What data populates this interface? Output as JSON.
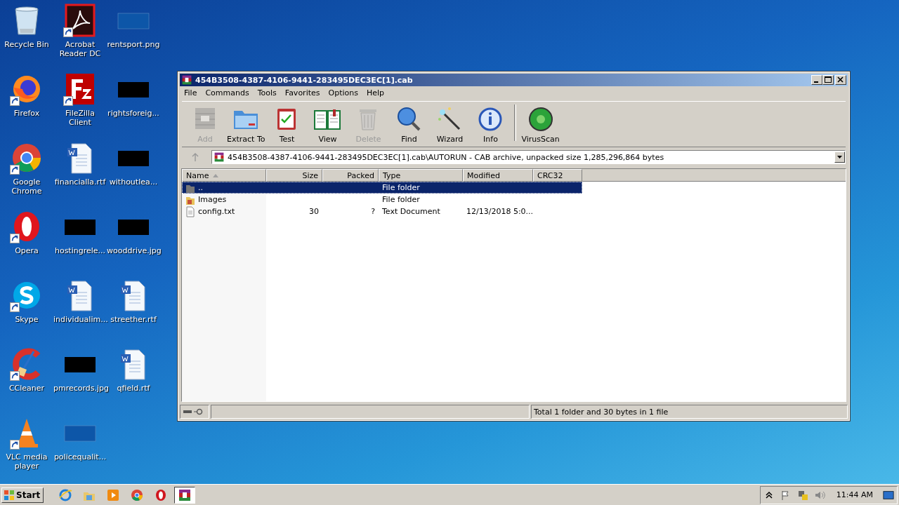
{
  "desktop_icons": [
    {
      "label": "Recycle Bin",
      "kind": "recycle",
      "shortcut": false
    },
    {
      "label": "Firefox",
      "kind": "firefox",
      "shortcut": true
    },
    {
      "label": "Google Chrome",
      "kind": "chrome",
      "shortcut": true
    },
    {
      "label": "Opera",
      "kind": "opera",
      "shortcut": true
    },
    {
      "label": "Skype",
      "kind": "skype",
      "shortcut": true
    },
    {
      "label": "CCleaner",
      "kind": "ccleaner",
      "shortcut": true
    },
    {
      "label": "VLC media player",
      "kind": "vlc",
      "shortcut": true
    },
    {
      "label": "Acrobat Reader DC",
      "kind": "acrobat",
      "shortcut": true
    },
    {
      "label": "FileZilla Client",
      "kind": "filezilla",
      "shortcut": true
    },
    {
      "label": "financialla.rtf",
      "kind": "word",
      "shortcut": false
    },
    {
      "label": "hostingrele...",
      "kind": "dark-image",
      "shortcut": false
    },
    {
      "label": "individualim...",
      "kind": "word",
      "shortcut": false
    },
    {
      "label": "pmrecords.jpg",
      "kind": "dark-image",
      "shortcut": false
    },
    {
      "label": "policequalit...",
      "kind": "blank-image",
      "shortcut": false
    },
    {
      "label": "rentsport.png",
      "kind": "blank-image",
      "shortcut": false
    },
    {
      "label": "rightsforeig...",
      "kind": "dark-image",
      "shortcut": false
    },
    {
      "label": "withoutlea...",
      "kind": "dark-image",
      "shortcut": false
    },
    {
      "label": "wooddrive.jpg",
      "kind": "dark-image",
      "shortcut": false
    },
    {
      "label": "streether.rtf",
      "kind": "word",
      "shortcut": false
    },
    {
      "label": "qfield.rtf",
      "kind": "word",
      "shortcut": false
    }
  ],
  "window": {
    "title": "454B3508-4387-4106-9441-283495DEC3EC[1].cab",
    "menu": [
      "File",
      "Commands",
      "Tools",
      "Favorites",
      "Options",
      "Help"
    ],
    "toolbar": [
      {
        "label": "Add",
        "kind": "add",
        "disabled": true
      },
      {
        "label": "Extract To",
        "kind": "extract",
        "disabled": false
      },
      {
        "label": "Test",
        "kind": "test",
        "disabled": false
      },
      {
        "label": "View",
        "kind": "view",
        "disabled": false
      },
      {
        "label": "Delete",
        "kind": "delete",
        "disabled": true
      },
      {
        "label": "Find",
        "kind": "find",
        "disabled": false
      },
      {
        "label": "Wizard",
        "kind": "wizard",
        "disabled": false
      },
      {
        "label": "Info",
        "kind": "info",
        "disabled": false
      },
      {
        "label": "VirusScan",
        "kind": "virusscan",
        "disabled": false
      }
    ],
    "address": "454B3508-4387-4106-9441-283495DEC3EC[1].cab\\AUTORUN - CAB archive, unpacked size 1,285,296,864 bytes",
    "columns": [
      "Name",
      "Size",
      "Packed",
      "Type",
      "Modified",
      "CRC32"
    ],
    "rows": [
      {
        "kind": "parent",
        "name": "..",
        "type": "File folder",
        "selected": true
      },
      {
        "kind": "folder",
        "name": "Images",
        "type": "File folder",
        "selected": false
      },
      {
        "kind": "file",
        "name": "config.txt",
        "size": "30",
        "packed": "?",
        "type": "Text Document",
        "modified": "12/13/2018 5:0...",
        "selected": false
      }
    ],
    "status": "Total 1 folder and 30 bytes in 1 file"
  },
  "taskbar": {
    "start": "Start",
    "items": [
      {
        "kind": "ie",
        "selected": false
      },
      {
        "kind": "explorer",
        "selected": false
      },
      {
        "kind": "media",
        "selected": false
      },
      {
        "kind": "chrome",
        "selected": false
      },
      {
        "kind": "opera",
        "selected": false
      },
      {
        "kind": "winrar",
        "selected": true
      }
    ],
    "clock": "11:44 AM"
  }
}
